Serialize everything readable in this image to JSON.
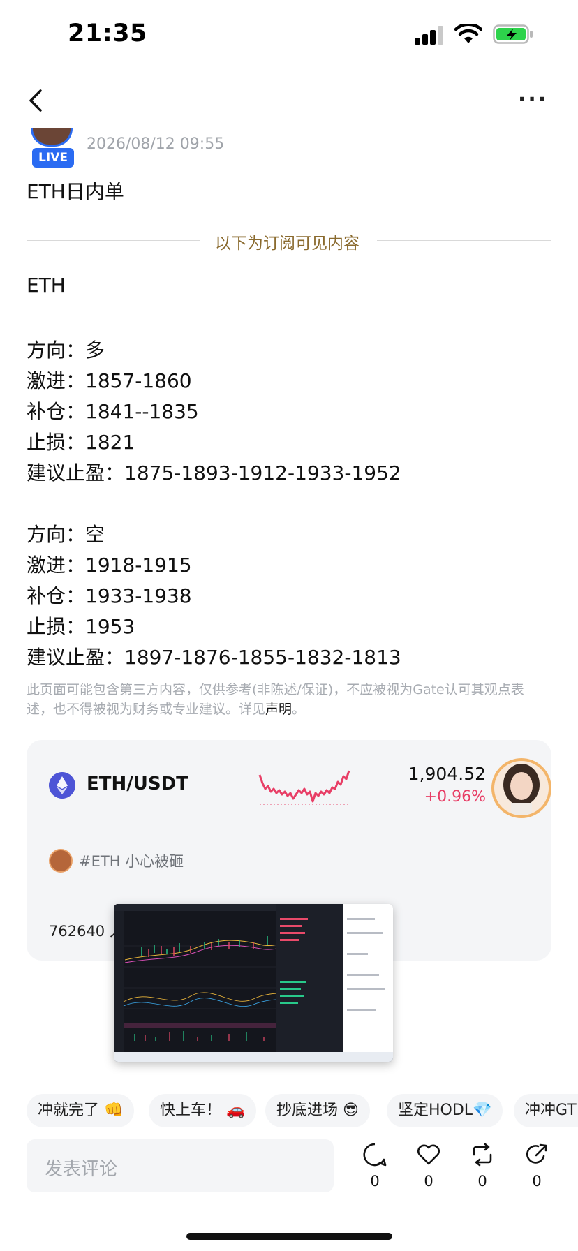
{
  "status_bar": {
    "time": "21:35"
  },
  "nav": {
    "more_label": "···"
  },
  "post": {
    "live_badge": "LIVE",
    "timestamp": "2026/08/12 09:55",
    "title": "ETH日内单",
    "subscriber_divider": "以下为订阅可见内容",
    "body_lines": [
      "ETH",
      "方向：多",
      "激进：1857-1860",
      "补仓：1841--1835",
      "止损：1821",
      "建议止盈：1875-1893-1912-1933-1952",
      "方向：空",
      "激进：1918-1915",
      "补仓：1933-1938",
      "止损：1953",
      "建议止盈：1897-1876-1855-1832-1813"
    ],
    "disclaimer_text": "此页面可能包含第三方内容，仅供参考(非陈述/保证)，不应被视为Gate认可其观点表述，也不得被视为财务或专业建议。详见",
    "disclaimer_link": "声明",
    "disclaimer_end": "。"
  },
  "market_card": {
    "pair": "ETH/USDT",
    "price": "1,904.52",
    "change": "+0.96%",
    "topic": "#ETH 小心被砸",
    "people_count": "762640 人"
  },
  "quick_replies": [
    "冲就完了 👊",
    "快上车！ 🚗",
    "抄底进场 😎",
    "坚定HODL💎",
    "冲冲GT"
  ],
  "comment": {
    "placeholder": "发表评论"
  },
  "actions": {
    "comment_count": "0",
    "like_count": "0",
    "repost_count": "0",
    "share_count": "0"
  },
  "colors": {
    "accent_blue": "#2a6bf2",
    "gain_red": "#e83e66",
    "divider_gold": "#8a6a2e",
    "eth_purple": "#4d54d6"
  }
}
